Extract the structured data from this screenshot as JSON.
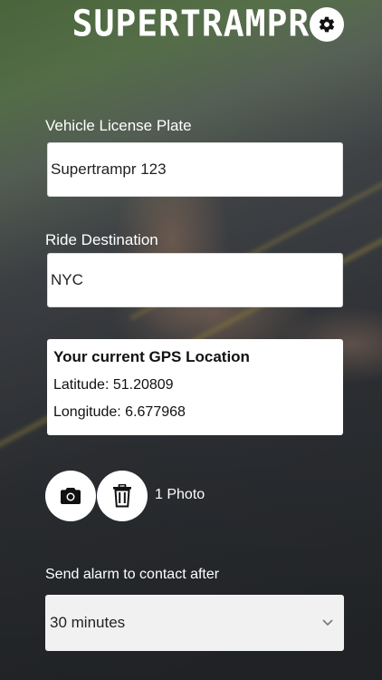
{
  "app": {
    "title": "SUPERTRAMPR"
  },
  "form": {
    "plate_label": "Vehicle License Plate",
    "plate_value": "Supertrampr 123",
    "destination_label": "Ride Destination",
    "destination_value": "NYC"
  },
  "gps": {
    "title": "Your current GPS Location",
    "latitude_text": "Latitude: 51.20809",
    "longitude_text": "Longitude: 6.677968"
  },
  "photos": {
    "count_text": "1 Photo",
    "camera_icon": "camera-icon",
    "trash_icon": "trash-icon"
  },
  "alarm": {
    "label": "Send alarm to contact after",
    "selected": "30 minutes"
  },
  "colors": {
    "accent": "#ffffff",
    "text_dark": "#222222"
  }
}
